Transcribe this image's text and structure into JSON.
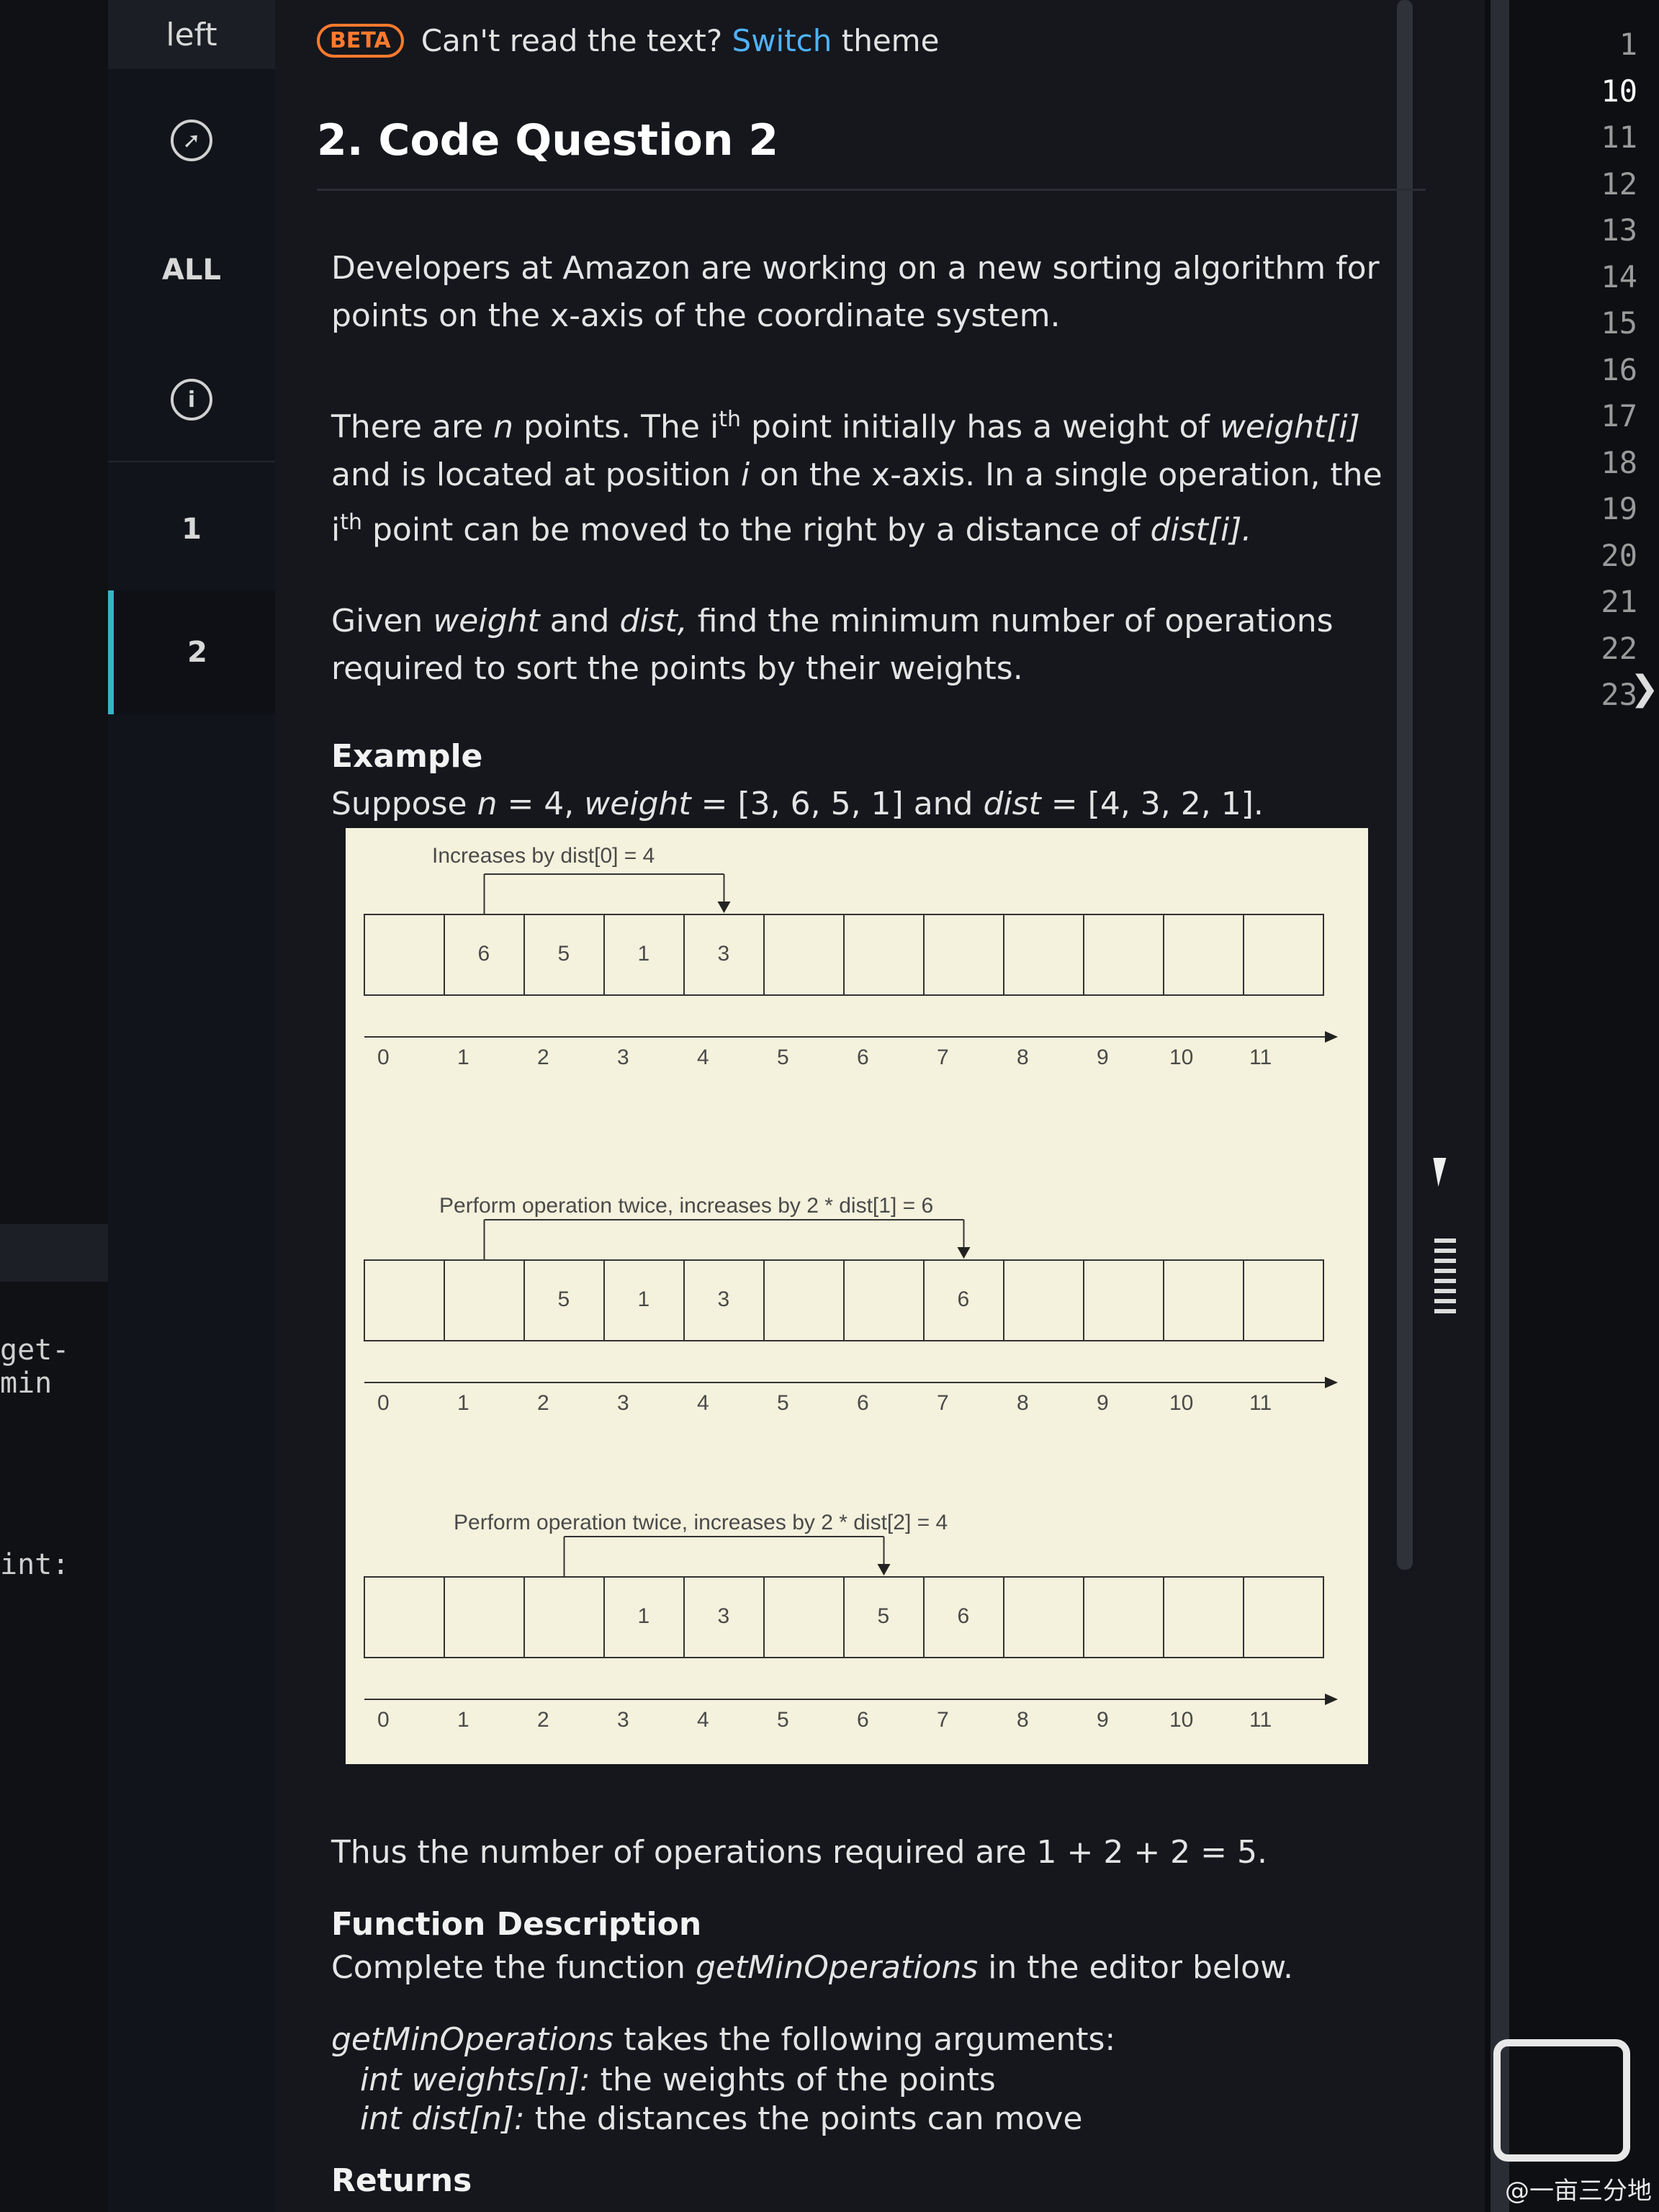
{
  "left_pane": {
    "code_line_1": "get-min",
    "code_line_2": "int:"
  },
  "nav": {
    "top_label": "left",
    "all_label": "ALL",
    "item1": "1",
    "item2": "2"
  },
  "banner": {
    "beta": "BETA",
    "text": "Can't read the text?",
    "link": "Switch",
    "suffix": "theme"
  },
  "question": {
    "title": "2. Code Question 2",
    "p1": "Developers at Amazon are working on a new sorting algorithm for points on the x-axis of the coordinate system.",
    "p2_a": "There are ",
    "p2_n": "n",
    "p2_b": " points. The i",
    "p2_th": "th",
    "p2_c": " point initially has a weight of ",
    "p2_w": "weight[i]",
    "p2_d": " and is located at position ",
    "p2_i": "i",
    "p2_e": " on the x-axis. In a single operation, the i",
    "p2_th2": "th",
    "p2_f": " point can be moved to the right by a distance of ",
    "p2_dist": "dist[i].",
    "p3_a": "Given ",
    "p3_w": "weight",
    "p3_b": " and ",
    "p3_d": "dist,",
    "p3_c": " find the minimum number of operations required to sort the points by their weights.",
    "example_heading": "Example",
    "example_a": "Suppose ",
    "example_n": "n",
    "example_b": " = 4, ",
    "example_w": "weight",
    "example_c": " = [3, 6, 5, 1] and ",
    "example_d": "dist",
    "example_e": " = [4, 3, 2, 1].",
    "thus": "Thus the number of operations required are 1 + 2 + 2 = 5.",
    "fd_heading": "Function Description",
    "fd_a": "Complete the function ",
    "fd_fn": "getMinOperations",
    "fd_b": " in the editor below.",
    "args_fn": "getMinOperations",
    "args_text": " takes the following arguments:",
    "arg1_sig": "int weights[n]:",
    "arg1_desc": " the weights of the points",
    "arg2_sig": "int dist[n]:",
    "arg2_desc": " the distances the points can move",
    "returns_heading": "Returns"
  },
  "figure": {
    "label1": "Increases by dist[0] = 4",
    "label2": "Perform operation twice, increases by 2 * dist[1] = 6",
    "label3": "Perform operation twice, increases by 2 * dist[2] = 4",
    "axis": [
      "0",
      "1",
      "2",
      "3",
      "4",
      "5",
      "6",
      "7",
      "8",
      "9",
      "10",
      "11"
    ],
    "row1": [
      "",
      "6",
      "5",
      "1",
      "3",
      "",
      "",
      "",
      "",
      "",
      "",
      ""
    ],
    "row2": [
      "",
      "",
      "5",
      "1",
      "3",
      "",
      "",
      "6",
      "",
      "",
      "",
      ""
    ],
    "row3": [
      "",
      "",
      "",
      "1",
      "3",
      "",
      "5",
      "6",
      "",
      "",
      "",
      ""
    ]
  },
  "editor": {
    "line_numbers": [
      "1",
      "10",
      "11",
      "12",
      "13",
      "14",
      "15",
      "16",
      "17",
      "18",
      "19",
      "20",
      "21",
      "22",
      "23"
    ],
    "current_line": "10"
  },
  "watermark": "@一亩三分地"
}
